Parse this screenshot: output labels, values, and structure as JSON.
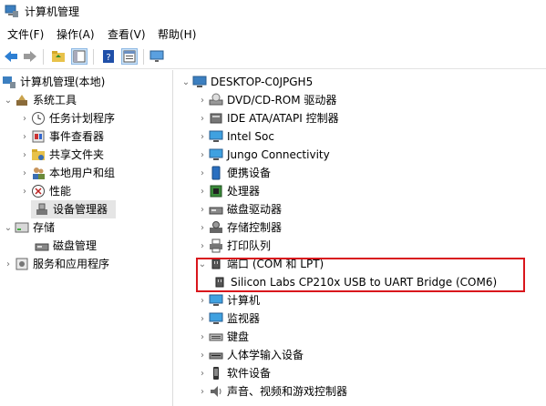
{
  "window": {
    "title": "计算机管理"
  },
  "menu": [
    "文件(F)",
    "操作(A)",
    "查看(V)",
    "帮助(H)"
  ],
  "toolbar": {
    "icons": [
      "back-arrow",
      "forward-arrow",
      "up-folder",
      "show-hide-tree",
      "help",
      "properties",
      "monitor"
    ]
  },
  "left_tree": [
    {
      "label": "计算机管理(本地)",
      "icon": "computer-mgmt-icon"
    },
    {
      "label": "系统工具",
      "icon": "tools-icon"
    },
    {
      "label": "任务计划程序",
      "icon": "clock-icon"
    },
    {
      "label": "事件查看器",
      "icon": "event-viewer-icon"
    },
    {
      "label": "共享文件夹",
      "icon": "shared-folder-icon"
    },
    {
      "label": "本地用户和组",
      "icon": "users-icon"
    },
    {
      "label": "性能",
      "icon": "performance-icon"
    },
    {
      "label": "设备管理器",
      "icon": "device-manager-icon"
    },
    {
      "label": "存储",
      "icon": "storage-icon"
    },
    {
      "label": "磁盘管理",
      "icon": "disk-mgmt-icon"
    },
    {
      "label": "服务和应用程序",
      "icon": "services-icon"
    }
  ],
  "device_tree": {
    "root": "DESKTOP-C0JPGH5",
    "categories": [
      "DVD/CD-ROM 驱动器",
      "IDE ATA/ATAPI 控制器",
      "Intel Soc",
      "Jungo Connectivity",
      "便携设备",
      "处理器",
      "磁盘驱动器",
      "存储控制器",
      "打印队列",
      "端口 (COM 和 LPT)",
      "Silicon Labs CP210x USB to UART Bridge (COM6)",
      "计算机",
      "监视器",
      "键盘",
      "人体学输入设备",
      "软件设备",
      "声音、视频和游戏控制器"
    ]
  },
  "colors": {
    "highlight_box": "#d9161c",
    "selected_row": "#e5e5e5"
  }
}
